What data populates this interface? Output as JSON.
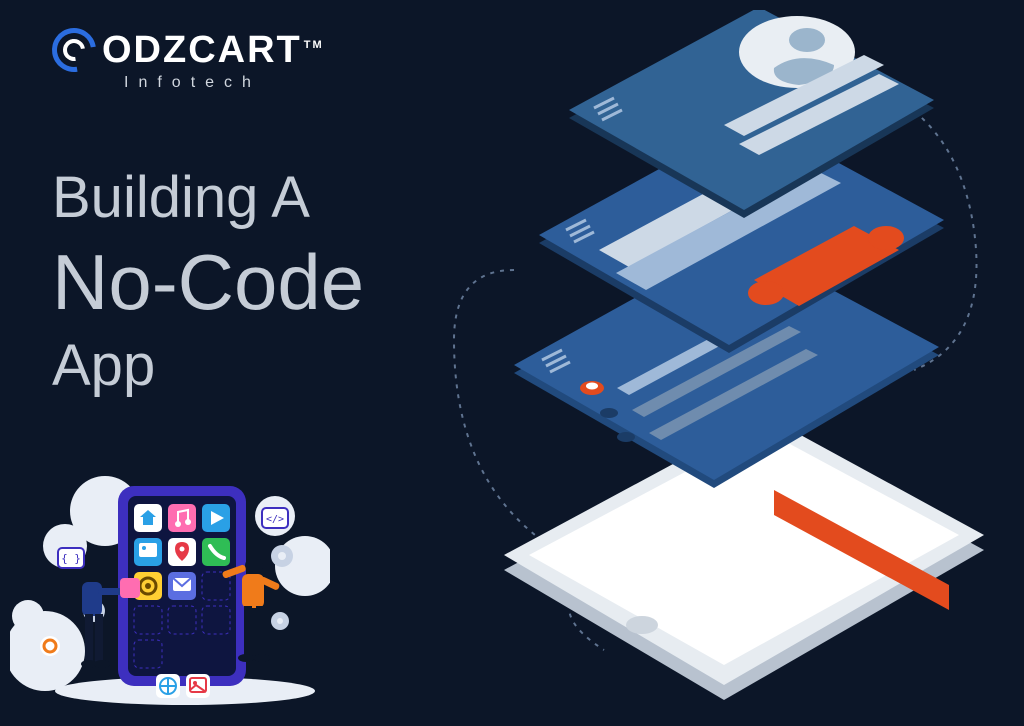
{
  "logo": {
    "brand": "ODZCART",
    "tm": "TM",
    "subtitle": "Infotech"
  },
  "headline": {
    "line1": "Building A",
    "line2": "No-Code",
    "line3": "App"
  },
  "colors": {
    "background": "#0c1628",
    "accent_blue": "#2b6de0",
    "panel_blue": "#2d5d9a",
    "panel_blue_dark": "#1b3c66",
    "orange": "#e34b1e",
    "device_light": "#e3e7ec",
    "device_side": "#b8c2cf",
    "mini_purple": "#3d2fbf",
    "mini_person1": "#1f3b8a",
    "mini_person2": "#f07b1a"
  },
  "mini_icons": [
    {
      "name": "home",
      "bg": "#ffffff",
      "fg": "#2aa0e6"
    },
    {
      "name": "music",
      "bg": "#ff6db1",
      "fg": "#ffffff"
    },
    {
      "name": "play",
      "bg": "#2aa0e6",
      "fg": "#ffffff"
    },
    {
      "name": "image",
      "bg": "#2aa0e6",
      "fg": "#ffffff"
    },
    {
      "name": "pin",
      "bg": "#ffffff",
      "fg": "#e63946"
    },
    {
      "name": "phone",
      "bg": "#2fbd55",
      "fg": "#ffffff"
    },
    {
      "name": "gear",
      "bg": "#ffcf33",
      "fg": "#6a4a00"
    },
    {
      "name": "mail",
      "bg": "#5b6ee1",
      "fg": "#ffffff"
    },
    {
      "name": "globe",
      "bg": "#ffffff",
      "fg": "#2aa0e6"
    },
    {
      "name": "picture",
      "bg": "#ffffff",
      "fg": "#e63946"
    }
  ]
}
